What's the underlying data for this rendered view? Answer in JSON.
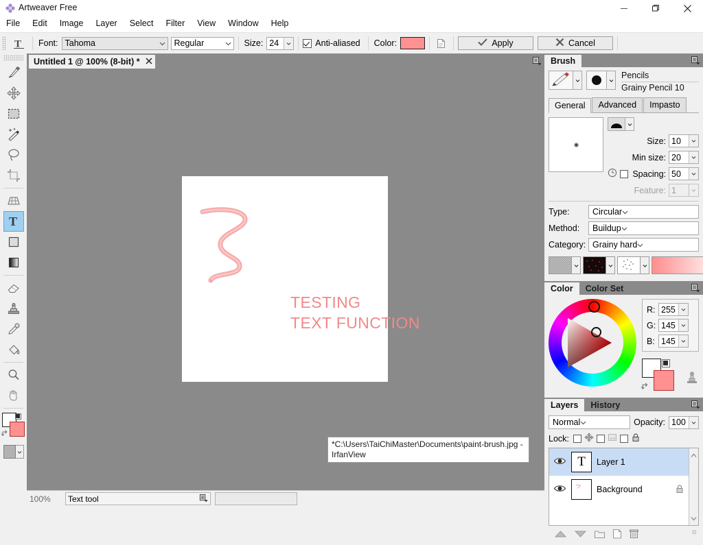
{
  "window": {
    "title": "Artweaver Free",
    "app_icon": "artweaver-flower-icon",
    "minimize": "minimize-icon",
    "maximize": "restore-icon",
    "close": "close-icon"
  },
  "menu": {
    "items": [
      "File",
      "Edit",
      "Image",
      "Layer",
      "Select",
      "Filter",
      "View",
      "Window",
      "Help"
    ]
  },
  "options_bar": {
    "tool_icon": "text-tool-icon",
    "font_label": "Font:",
    "font_value": "Tahoma",
    "style_value": "Regular",
    "size_label": "Size:",
    "size_value": "24",
    "antialiased_label": "Anti-aliased",
    "antialiased_checked": true,
    "color_label": "Color:",
    "color_value": "#ff9191",
    "page_icon": "document-icon",
    "apply_label": "Apply",
    "apply_icon": "check-icon",
    "cancel_label": "Cancel",
    "cancel_icon": "x-icon"
  },
  "tools": [
    {
      "name": "brush-tool",
      "icon": "paintbrush-icon",
      "selected": false
    },
    {
      "name": "transform-tool",
      "icon": "move-arrows-icon",
      "selected": false
    },
    {
      "name": "rectangular-select-tool",
      "icon": "marquee-icon",
      "selected": false
    },
    {
      "name": "magic-wand-tool",
      "icon": "magic-wand-icon",
      "selected": false
    },
    {
      "name": "lasso-tool",
      "icon": "lasso-icon",
      "selected": false
    },
    {
      "name": "crop-tool",
      "icon": "crop-icon",
      "selected": false
    },
    {
      "name": "perspective-tool",
      "icon": "grid-perspective-icon",
      "selected": false
    },
    {
      "name": "text-tool",
      "icon": "text-T-icon",
      "selected": true
    },
    {
      "name": "shape-tool",
      "icon": "rectangle-shape-icon",
      "selected": false
    },
    {
      "name": "gradient-tool",
      "icon": "gradient-icon",
      "selected": false
    },
    {
      "name": "eraser-tool",
      "icon": "eraser-icon",
      "selected": false
    },
    {
      "name": "clone-stamp-tool",
      "icon": "stamp-icon",
      "selected": false
    },
    {
      "name": "eyedropper-tool",
      "icon": "eyedropper-icon",
      "selected": false
    },
    {
      "name": "paint-bucket-tool",
      "icon": "paint-bucket-icon",
      "selected": false
    },
    {
      "name": "zoom-tool",
      "icon": "magnifier-icon",
      "selected": false
    },
    {
      "name": "hand-tool",
      "icon": "hand-icon",
      "selected": false
    }
  ],
  "tool_colors": {
    "foreground": "#ff9191",
    "background": "#ffffff",
    "swap_icon": "swap-colors-icon",
    "reset_icon": "reset-colors-icon",
    "texture_icon": "texture-swatch-icon"
  },
  "document": {
    "tab_label": "Untitled 1 @ 100% (8-bit) *",
    "close_icon": "close-icon",
    "tab_menu_icon": "panel-menu-icon",
    "canvas_text_line1": "TESTING",
    "canvas_text_line2": "TEXT FUNCTION",
    "canvas_text_color": "#f08a8a"
  },
  "tooltip": {
    "text": "*C:\\Users\\TaiChiMaster\\Documents\\paint-brush.jpg - IrfanView"
  },
  "status_bar": {
    "zoom": "100%",
    "tool": "Text tool",
    "menu_icon": "panel-menu-icon"
  },
  "brush_panel": {
    "tab_label": "Brush",
    "menu_icon": "panel-menu-icon",
    "brush_preview_icon": "pencil-preview-icon",
    "tip_preview_icon": "round-tip-icon",
    "category_name": "Pencils",
    "brush_name": "Grainy Pencil 10",
    "tabs": [
      {
        "label": "General",
        "active": true
      },
      {
        "label": "Advanced",
        "active": false
      },
      {
        "label": "Impasto",
        "active": false
      }
    ],
    "shape_icon": "brush-shape-icon",
    "fields": [
      {
        "label": "Size:",
        "value": "10",
        "disabled": false
      },
      {
        "label": "Min size:",
        "value": "20",
        "disabled": false
      },
      {
        "label": "Spacing:",
        "value": "50",
        "disabled": false
      },
      {
        "label": "Feature:",
        "value": "1",
        "disabled": true
      }
    ],
    "timing_icon": "clock-icon",
    "timing_checked": false,
    "selects": [
      {
        "label": "Type:",
        "value": "Circular"
      },
      {
        "label": "Method:",
        "value": "Buildup"
      },
      {
        "label": "Category:",
        "value": "Grainy hard"
      }
    ],
    "textures": [
      {
        "name": "paper-texture-swatch"
      },
      {
        "name": "grain-texture-swatch"
      },
      {
        "name": "pattern-texture-swatch"
      },
      {
        "name": "gradient-swatch"
      }
    ]
  },
  "color_panel": {
    "tabs": [
      {
        "label": "Color",
        "active": true
      },
      {
        "label": "Color Set",
        "active": false
      }
    ],
    "menu_icon": "panel-menu-icon",
    "channels": [
      {
        "label": "R:",
        "value": "255"
      },
      {
        "label": "G:",
        "value": "145"
      },
      {
        "label": "B:",
        "value": "145"
      }
    ],
    "foreground": "#ff9191",
    "background": "#ffffff",
    "stamp_icon": "color-stamp-icon",
    "swap_icon": "swap-colors-icon"
  },
  "layers_panel": {
    "tabs": [
      {
        "label": "Layers",
        "active": true
      },
      {
        "label": "History",
        "active": false
      }
    ],
    "menu_icon": "panel-menu-icon",
    "blend_mode": "Normal",
    "opacity_label": "Opacity:",
    "opacity_value": "100",
    "lock_label": "Lock:",
    "lock_items": [
      {
        "name": "lock-transparency",
        "icon": "move-arrows-icon",
        "checked": false
      },
      {
        "name": "lock-pixels",
        "icon": "pixels-icon",
        "checked": false
      },
      {
        "name": "lock-all",
        "icon": "lock-icon",
        "checked": false
      }
    ],
    "layers": [
      {
        "name": "Layer 1",
        "thumb": "T",
        "visible": true,
        "selected": true,
        "locked": false
      },
      {
        "name": "Background",
        "thumb": "",
        "visible": true,
        "selected": false,
        "locked": true
      }
    ],
    "buttons": [
      {
        "name": "move-layer-up-button",
        "icon": "triangle-up-icon"
      },
      {
        "name": "move-layer-down-button",
        "icon": "triangle-down-icon"
      },
      {
        "name": "new-group-button",
        "icon": "folder-icon"
      },
      {
        "name": "new-layer-button",
        "icon": "page-icon"
      },
      {
        "name": "delete-layer-button",
        "icon": "trash-icon"
      }
    ]
  }
}
